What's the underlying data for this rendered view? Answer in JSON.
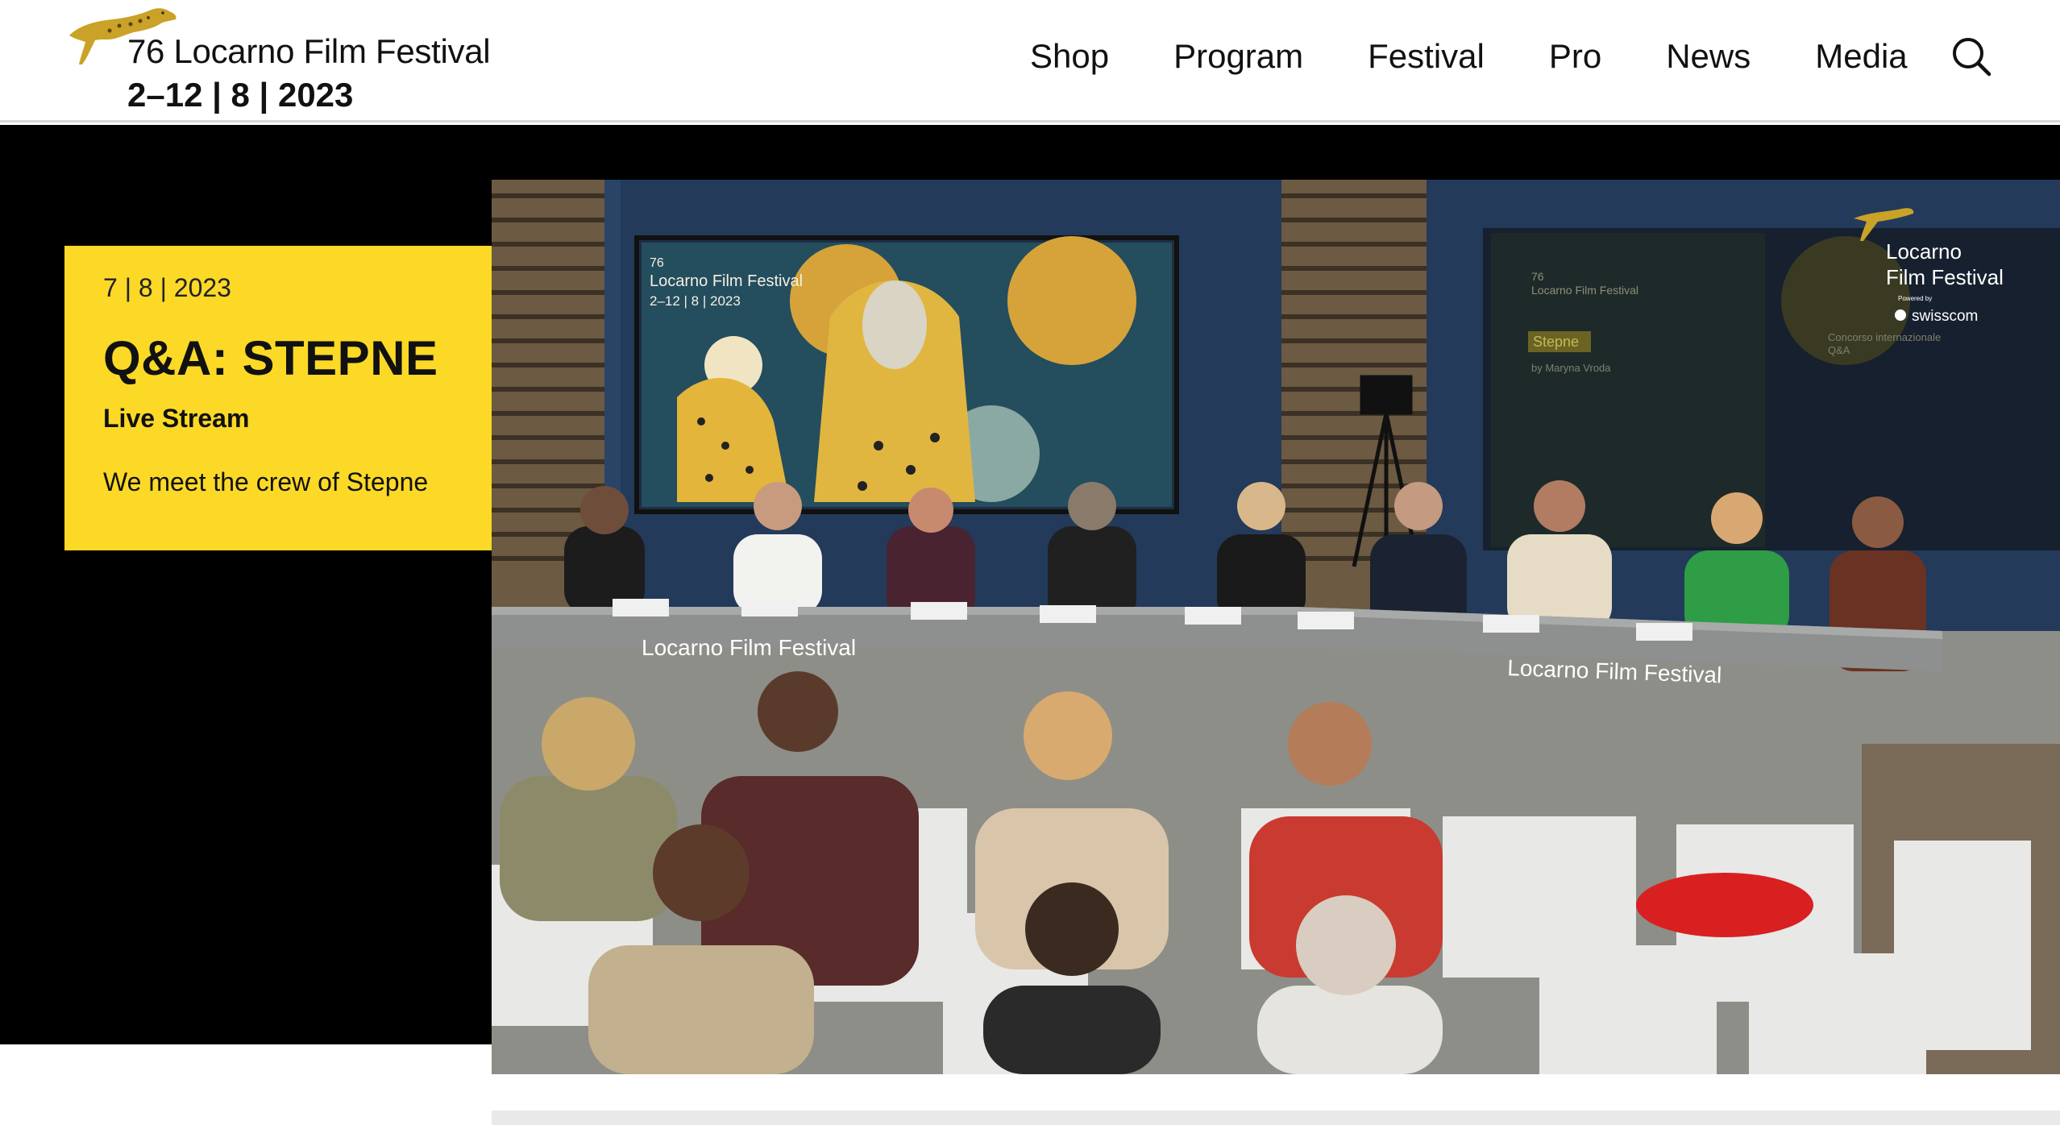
{
  "header": {
    "logo_title": "76 Locarno Film Festival",
    "logo_dates": "2–12 | 8 | 2023",
    "nav": [
      "Shop",
      "Program",
      "Festival",
      "Pro",
      "News",
      "Media"
    ],
    "search_icon": "search-icon"
  },
  "card": {
    "date": "7 | 8 | 2023",
    "title": "Q&A: STEPNE",
    "subtitle": "Live Stream",
    "description": "We meet the crew of Stepne"
  },
  "video": {
    "poster_number": "76",
    "poster_title": "Locarno Film Festival",
    "poster_dates": "2–12 | 8 | 2023",
    "table_label_left": "Locarno Film Festival",
    "table_label_right": "Locarno Film Festival",
    "screen_number": "76",
    "screen_title": "Locarno Film Festival",
    "screen_film": "Stepne",
    "screen_director": "by Maryna Vroda",
    "screen_section": "Concorso internazionale",
    "screen_qa": "Q&A",
    "watermark_line1": "Locarno",
    "watermark_line2": "Film Festival",
    "watermark_powered": "Powered by",
    "watermark_sponsor": "swisscom"
  },
  "colors": {
    "accent_yellow": "#fbd926",
    "hero_black": "#000000",
    "header_text": "#111111"
  }
}
